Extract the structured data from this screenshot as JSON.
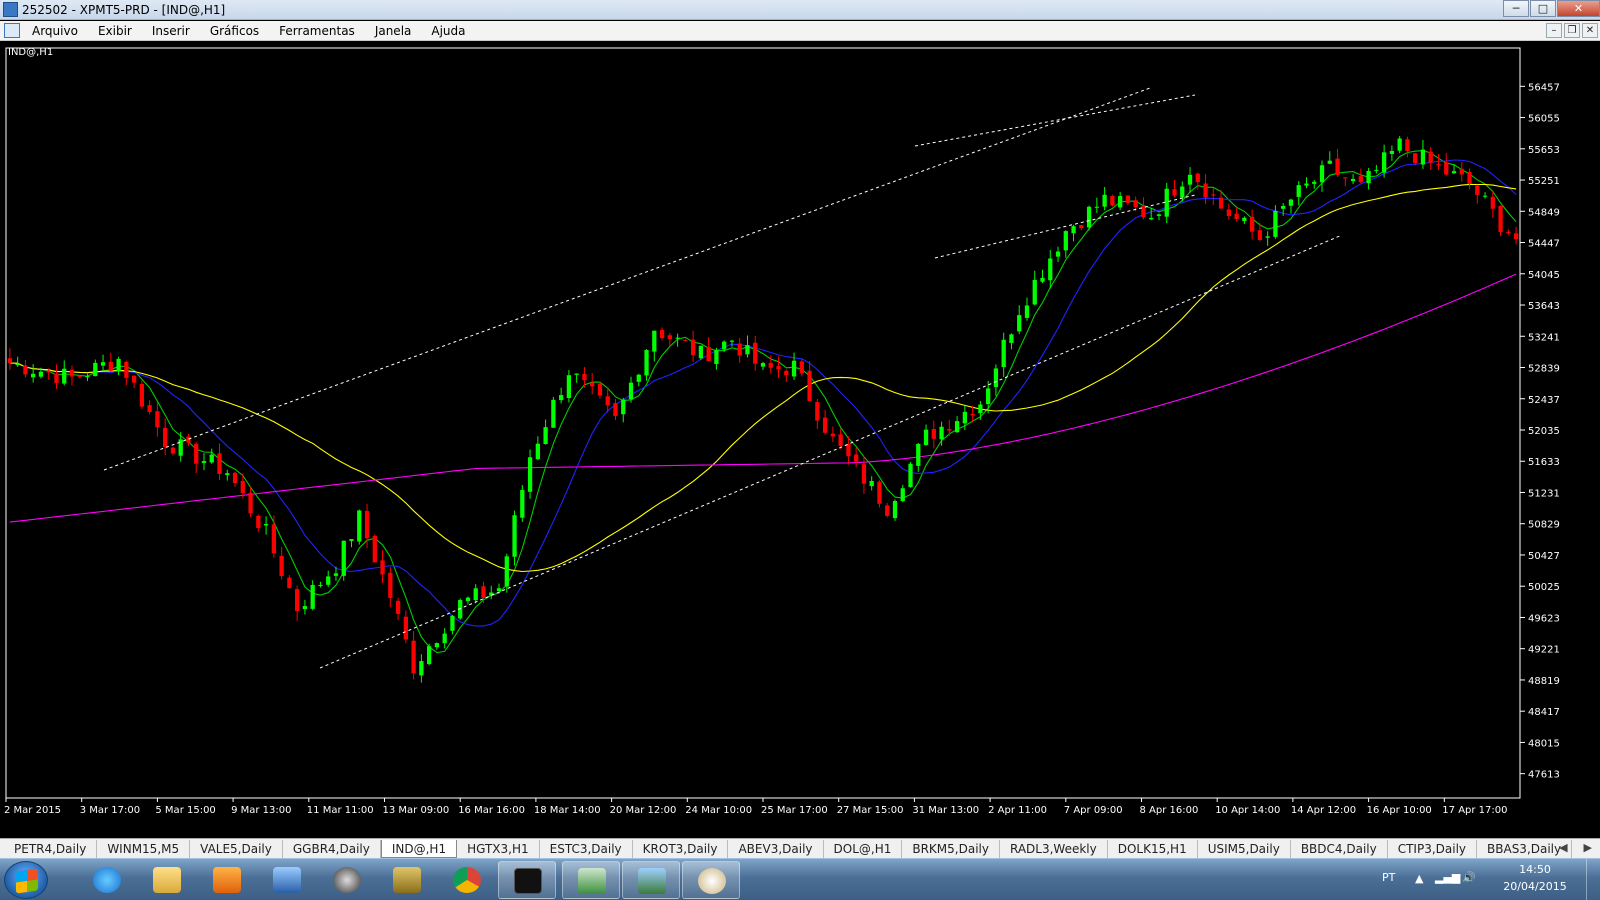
{
  "window": {
    "title": "252502 - XPMT5-PRD - [IND@,H1]",
    "minimize": "─",
    "maximize": "□",
    "close": "✕"
  },
  "menu": {
    "items": [
      "Arquivo",
      "Exibir",
      "Inserir",
      "Gráficos",
      "Ferramentas",
      "Janela",
      "Ajuda"
    ]
  },
  "mdi": {
    "minimize": "–",
    "restore": "❐",
    "close": "✕"
  },
  "chart_data": {
    "type": "candlestick",
    "symbol_label": "IND@,H1",
    "y_ticks": [
      56457,
      56055,
      55653,
      55251,
      54849,
      54447,
      54045,
      53643,
      53241,
      52839,
      52437,
      52035,
      51633,
      51231,
      50829,
      50427,
      50025,
      49623,
      49221,
      48819,
      48417,
      48015,
      47613
    ],
    "x_labels": [
      "2 Mar 2015",
      "3 Mar 17:00",
      "5 Mar 15:00",
      "9 Mar 13:00",
      "11 Mar 11:00",
      "13 Mar 09:00",
      "16 Mar 16:00",
      "18 Mar 14:00",
      "20 Mar 12:00",
      "24 Mar 10:00",
      "25 Mar 17:00",
      "27 Mar 15:00",
      "31 Mar 13:00",
      "2 Apr 11:00",
      "7 Apr 09:00",
      "8 Apr 16:00",
      "10 Apr 14:00",
      "14 Apr 12:00",
      "16 Apr 10:00",
      "17 Apr 17:00"
    ],
    "ylim": [
      47300,
      56950
    ],
    "bars": 195,
    "anchors": [
      [
        0,
        52900
      ],
      [
        8,
        52700
      ],
      [
        14,
        52950
      ],
      [
        20,
        51900
      ],
      [
        28,
        51500
      ],
      [
        33,
        50700
      ],
      [
        37,
        49750
      ],
      [
        42,
        50300
      ],
      [
        45,
        50900
      ],
      [
        49,
        49900
      ],
      [
        52,
        49000
      ],
      [
        58,
        49800
      ],
      [
        63,
        50000
      ],
      [
        67,
        51700
      ],
      [
        72,
        52800
      ],
      [
        78,
        52150
      ],
      [
        83,
        53350
      ],
      [
        89,
        53000
      ],
      [
        93,
        53200
      ],
      [
        97,
        52800
      ],
      [
        101,
        52850
      ],
      [
        106,
        51900
      ],
      [
        113,
        51050
      ],
      [
        118,
        51950
      ],
      [
        125,
        52400
      ],
      [
        130,
        53600
      ],
      [
        136,
        54600
      ],
      [
        141,
        55000
      ],
      [
        147,
        54800
      ],
      [
        152,
        55400
      ],
      [
        156,
        54900
      ],
      [
        161,
        54500
      ],
      [
        165,
        55000
      ],
      [
        170,
        55400
      ],
      [
        174,
        55150
      ],
      [
        179,
        55700
      ],
      [
        184,
        55400
      ],
      [
        188,
        55200
      ],
      [
        192,
        54700
      ],
      [
        194,
        54500
      ]
    ],
    "moving_averages": [
      {
        "color": "#00cc00",
        "period": 5
      },
      {
        "color": "#2222ff",
        "period": 12
      },
      {
        "color": "#ffff00",
        "period": 40
      },
      {
        "color": "#ff00ff",
        "period": 200
      }
    ],
    "up_color": "#00ff00",
    "down_color": "#ff0000",
    "grid": false
  },
  "tabs": {
    "items": [
      "PETR4,Daily",
      "WINM15,M5",
      "VALE5,Daily",
      "GGBR4,Daily",
      "IND@,H1",
      "HGTX3,H1",
      "ESTC3,Daily",
      "KROT3,Daily",
      "ABEV3,Daily",
      "DOL@,H1",
      "BRKM5,Daily",
      "RADL3,Weekly",
      "DOLK15,H1",
      "USIM5,Daily",
      "BBDC4,Daily",
      "CTIP3,Daily",
      "BBAS3,Daily"
    ],
    "active": "IND@,H1",
    "prev": "◀",
    "next": "▶"
  },
  "tray": {
    "lang": "PT",
    "time": "14:50",
    "date": "20/04/2015"
  },
  "taskbar": {
    "apps": [
      "internet-explorer",
      "file-explorer",
      "media-player",
      "network-app",
      "hp-app",
      "folder-app",
      "chrome",
      "xp-investimentos",
      "metatrader",
      "photo-viewer",
      "paint"
    ]
  }
}
